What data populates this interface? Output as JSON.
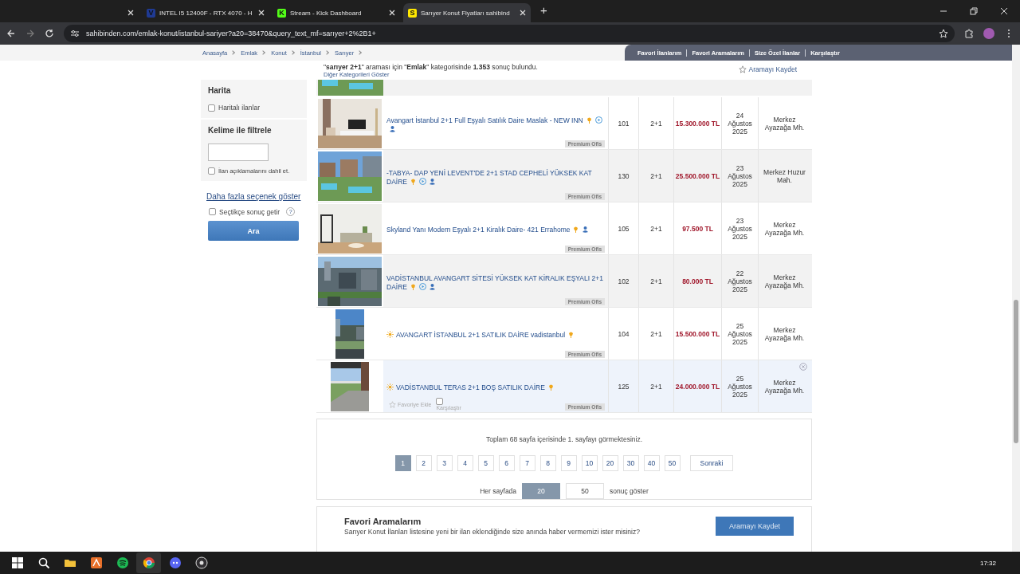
{
  "browser": {
    "tabs": [
      {
        "selected": false
      },
      {
        "title": "INTEL I5 12400F - RTX 4070 - H",
        "favicon": {
          "letter": "V",
          "color": "#1f3a93"
        },
        "selected": false
      },
      {
        "title": "Stream - Kick Dashboard",
        "favicon": {
          "letter": "K",
          "color": "#53fc18"
        },
        "selected": false
      },
      {
        "title": "Sarıyer Konut Fiyatları sahibind",
        "favicon": {
          "letter": "S",
          "color": "#ffe800"
        },
        "selected": true
      }
    ],
    "new_tab": "+",
    "url": "sahibinden.com/emlak-konut/istanbul-sariyer?a20=38470&query_text_mf=sarıyer+2%2B1+"
  },
  "header": {
    "breadcrumbs": [
      "Anasayfa",
      "Emlak",
      "Konut",
      "İstanbul",
      "Sarıyer"
    ],
    "top_links": [
      "Favori İlanlarım",
      "Favori Aramalarım",
      "Size Özel İlanlar",
      "Karşılaştır"
    ],
    "summary": "\"**sarıyer 2+1**\" araması için \"**Emlak**\" kategorisinde **1.353** sonuç bulundu.",
    "other_categories": "Diğer Kategorileri Göster",
    "save_search": "Aramayı Kaydet"
  },
  "sidebar": {
    "map_title": "Harita",
    "map_checkbox": {
      "label": "Haritalı ilanlar",
      "checked": false
    },
    "keyword_title": "Kelime ile filtrele",
    "keyword_checkbox": {
      "label": "İlan açıklamalarını dahil et.",
      "checked": false
    },
    "more_options": "Daha fazla seçenek göster",
    "instant": {
      "label": "Seçtikçe sonuç getir",
      "checked": false,
      "help": "?"
    },
    "search_button": "Ara"
  },
  "listings": [
    {
      "title": "Avangart İstanbul 2+1 Full Eşyalı Satılık Daire Maslak - NEW INN",
      "featured": false,
      "pinned": true,
      "video": true,
      "tour": true,
      "badge": "Premium Ofis",
      "m2": "101",
      "rooms": "2+1",
      "price": "15.300.000 TL",
      "date": "24 Ağustos 2025",
      "location": "Merkez Ayazağa Mh.",
      "hovered": false
    },
    {
      "title": "-TABYA- DAP YENİ LEVENT'DE 2+1 STAD CEPHELİ YÜKSEK KAT DAİRE",
      "featured": false,
      "pinned": true,
      "video": true,
      "tour": true,
      "badge": "Premium Ofis",
      "m2": "130",
      "rooms": "2+1",
      "price": "25.500.000 TL",
      "date": "23 Ağustos 2025",
      "location": "Merkez Huzur Mah.",
      "hovered": false
    },
    {
      "title": "Skyland Yanı Modern Eşyalı 2+1 Kiralık Daire- 421 Errahome",
      "featured": false,
      "pinned": true,
      "video": false,
      "tour": true,
      "badge": "Premium Ofis",
      "m2": "105",
      "rooms": "2+1",
      "price": "97.500 TL",
      "date": "23 Ağustos 2025",
      "location": "Merkez Ayazağa Mh.",
      "hovered": false
    },
    {
      "title": "VADİSTANBUL AVANGART SİTESİ YÜKSEK KAT KİRALIK EŞYALI 2+1 DAİRE",
      "featured": false,
      "pinned": true,
      "video": true,
      "tour": true,
      "badge": "Premium Ofis",
      "m2": "102",
      "rooms": "2+1",
      "price": "80.000 TL",
      "date": "22 Ağustos 2025",
      "location": "Merkez Ayazağa Mh.",
      "hovered": false
    },
    {
      "title": "AVANGART İSTANBUL 2+1 SATILIK DAİRE vadistanbul",
      "featured": true,
      "pinned": true,
      "video": false,
      "tour": false,
      "badge": "Premium Ofis",
      "m2": "104",
      "rooms": "2+1",
      "price": "15.500.000 TL",
      "date": "25 Ağustos 2025",
      "location": "Merkez Ayazağa Mh.",
      "hovered": false
    },
    {
      "title": "VADİSTANBUL TERAS 2+1 BOŞ SATILIK DAİRE",
      "featured": true,
      "pinned": true,
      "video": false,
      "tour": false,
      "badge": "Premium Ofis",
      "m2": "125",
      "rooms": "2+1",
      "price": "24.000.000 TL",
      "date": "25 Ağustos 2025",
      "location": "Merkez Ayazağa Mh.",
      "hovered": true,
      "actions": {
        "favorite": "Favoriye Ekle",
        "compare": "Karşılaştır"
      }
    }
  ],
  "pagination": {
    "summary": "Toplam 68 sayfa içerisinde 1. sayfayı görmektesiniz.",
    "pages": [
      {
        "label": "1",
        "selected": true
      },
      {
        "label": "2",
        "selected": false
      },
      {
        "label": "3",
        "selected": false
      },
      {
        "label": "4",
        "selected": false
      },
      {
        "label": "5",
        "selected": false
      },
      {
        "label": "6",
        "selected": false
      },
      {
        "label": "7",
        "selected": false
      },
      {
        "label": "8",
        "selected": false
      },
      {
        "label": "9",
        "selected": false
      },
      {
        "label": "10",
        "selected": false
      },
      {
        "label": "20",
        "selected": false
      },
      {
        "label": "30",
        "selected": false
      },
      {
        "label": "40",
        "selected": false
      },
      {
        "label": "50",
        "selected": false
      }
    ],
    "next": "Sonraki",
    "per_page_label": "Her sayfada",
    "per_page": [
      {
        "label": "20",
        "selected": true
      },
      {
        "label": "50",
        "selected": false
      }
    ],
    "per_page_suffix": "sonuç göster"
  },
  "favorites": {
    "title": "Favori Aramalarım",
    "text": "Sarıyer Konut İlanları listesine yeni bir ilan eklendiğinde size anında haber vermemizi ister misiniz?",
    "button": "Aramayı Kaydet"
  },
  "taskbar": {
    "apps": [
      {
        "kind": "start",
        "selected": false
      },
      {
        "kind": "search",
        "selected": false
      },
      {
        "kind": "folder",
        "selected": false
      },
      {
        "kind": "tool",
        "selected": false
      },
      {
        "kind": "music",
        "selected": false
      },
      {
        "kind": "browser",
        "selected": true
      },
      {
        "kind": "chat",
        "selected": false
      },
      {
        "kind": "recorder",
        "selected": false
      }
    ],
    "time": "17:32"
  }
}
